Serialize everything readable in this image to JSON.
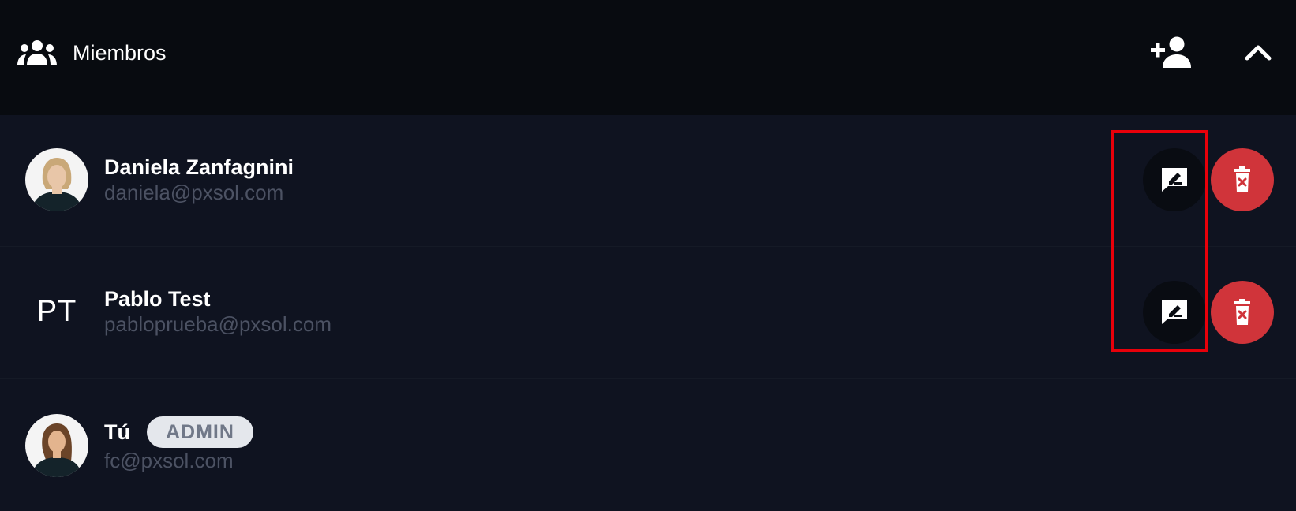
{
  "header": {
    "title": "Miembros",
    "icons": {
      "group": "group-icon",
      "add": "person-add-icon",
      "collapse": "chevron-up-icon"
    }
  },
  "members": [
    {
      "name": "Daniela Zanfagnini",
      "email": "daniela@pxsol.com",
      "avatar": "photo",
      "actions": {
        "edit": "edit-comment-icon",
        "delete": "trash-icon"
      }
    },
    {
      "name": "Pablo Test",
      "email": "pabloprueba@pxsol.com",
      "initials": "PT",
      "actions": {
        "edit": "edit-comment-icon",
        "delete": "trash-icon"
      }
    },
    {
      "name": "Tú",
      "email": "fc@pxsol.com",
      "avatar": "photo",
      "badge": "ADMIN"
    }
  ],
  "colors": {
    "header_bg": "#080b10",
    "list_bg": "#0f1320",
    "email": "#4c5263",
    "delete": "#d0343a",
    "badge_bg": "#e4e7ec",
    "badge_text": "#707888",
    "highlight": "#e8000a"
  }
}
